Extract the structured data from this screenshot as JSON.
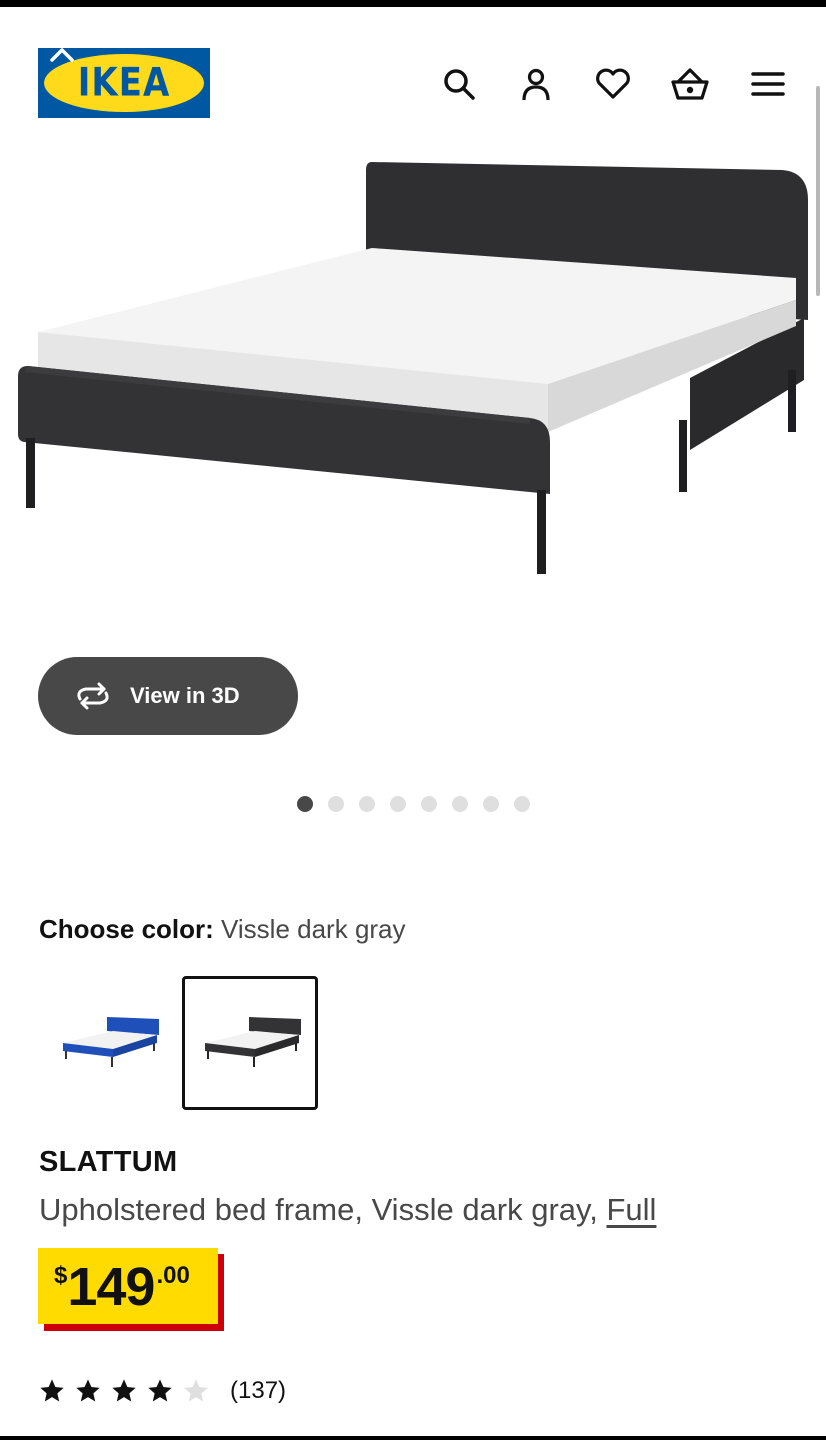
{
  "header": {
    "logo_text": "IKEA",
    "icons": [
      "search-icon",
      "account-icon",
      "heart-icon",
      "basket-icon",
      "menu-icon"
    ]
  },
  "gallery": {
    "view3d_label": "View in 3D",
    "page_count": 8,
    "active_index": 0
  },
  "color_picker": {
    "label": "Choose color:",
    "value": "Vissle dark gray",
    "options": [
      {
        "color": "#1f4fb8",
        "selected": false
      },
      {
        "color": "#333333",
        "selected": true
      }
    ]
  },
  "product": {
    "name": "SLATTUM",
    "description": "Upholstered bed frame, Vissle dark gray,",
    "size_link": "Full",
    "price": {
      "currency": "$",
      "integer": "149",
      "decimal": ".00"
    }
  },
  "rating": {
    "stars": 4,
    "max": 5,
    "count": "(137)"
  },
  "colors": {
    "ikea_blue": "#0058a3",
    "ikea_yellow": "#ffda1a",
    "price_red": "#cc0008",
    "button_gray": "#484848"
  }
}
